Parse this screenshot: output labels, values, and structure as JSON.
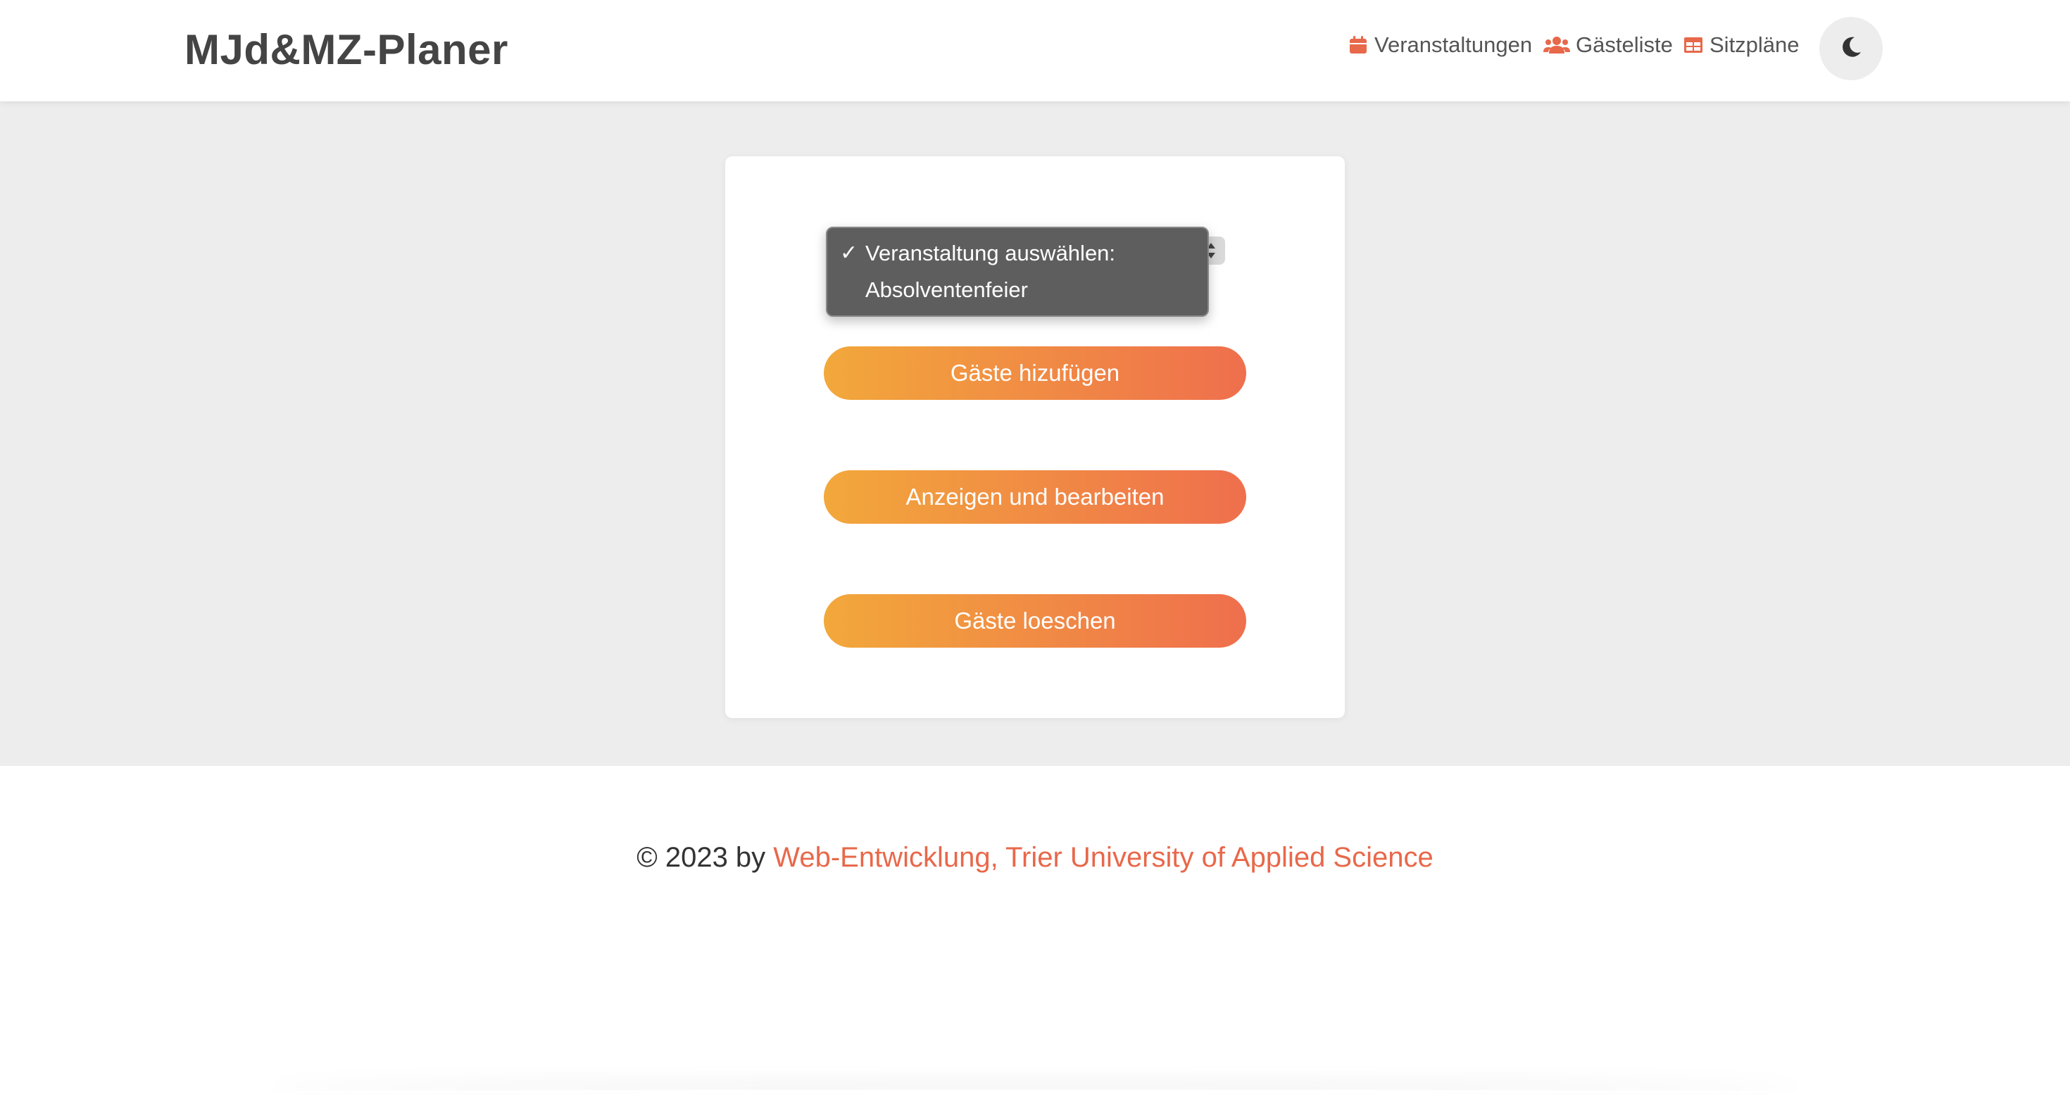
{
  "header": {
    "brand": "MJd&MZ-Planer",
    "nav": [
      {
        "label": "Veranstaltungen",
        "icon": "calendar-icon"
      },
      {
        "label": "Gästeliste",
        "icon": "users-icon"
      },
      {
        "label": "Sitzpläne",
        "icon": "table-icon"
      }
    ],
    "theme_toggle_icon": "moon-icon"
  },
  "event_select": {
    "options": [
      {
        "label": "Veranstaltung auswählen:",
        "selected": true
      },
      {
        "label": "Absolventenfeier",
        "selected": false
      }
    ],
    "check_mark": "✓"
  },
  "actions": [
    {
      "label": "Gäste hizufügen"
    },
    {
      "label": "Anzeigen und bearbeiten"
    },
    {
      "label": "Gäste loeschen"
    }
  ],
  "footer": {
    "prefix": "© 2023 by ",
    "link_text": "Web-Entwicklung, Trier University of Applied Science"
  },
  "colors": {
    "accent": "#e8684a",
    "gradient_start": "#f2a83b",
    "gradient_end": "#ef6f4d"
  }
}
